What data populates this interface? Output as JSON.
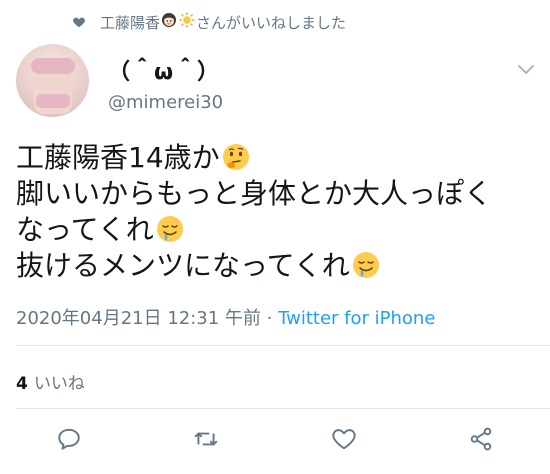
{
  "context": {
    "prefix": "工藤陽香",
    "suffix": "さんがいいねしました",
    "icons": [
      "heart-icon",
      "girl-emoji",
      "sun-emoji"
    ]
  },
  "user": {
    "display_name": "（＾ω＾）",
    "handle": "@mimerei30"
  },
  "tweet": {
    "lines": [
      {
        "text": "工藤陽香14歳か",
        "emoji": "thinking"
      },
      {
        "text": "脚いいからもっと身体とか大人っぽく",
        "emoji": ""
      },
      {
        "text": "なってくれ",
        "emoji": "drooling"
      },
      {
        "text": "抜けるメンツになってくれ",
        "emoji": "drooling"
      }
    ]
  },
  "meta": {
    "timestamp": "2020年04月21日 12:31 午前",
    "separator": " · ",
    "source": "Twitter for iPhone"
  },
  "stats": {
    "likes_count": "4",
    "likes_label": "いいね"
  },
  "actions": [
    "reply-icon",
    "retweet-icon",
    "like-icon",
    "share-icon"
  ],
  "colors": {
    "text": "#14171a",
    "secondary": "#657786",
    "link": "#1da1f2",
    "divider": "#e1e8ed"
  }
}
